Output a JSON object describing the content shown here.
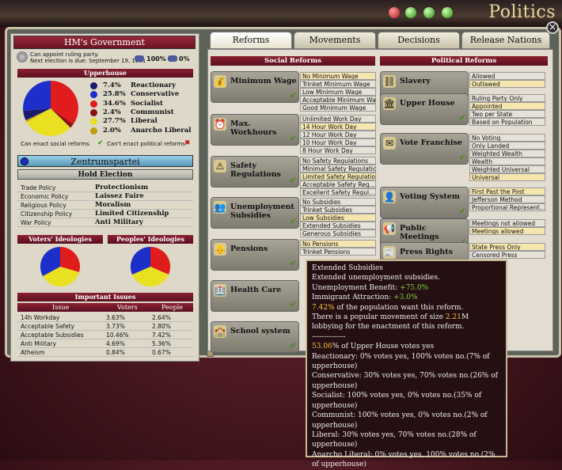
{
  "header": {
    "title": "Politics"
  },
  "government": {
    "title": "HM's Government",
    "line1": "Can appoint ruling party.",
    "line2": "Next election is due: September 19, 1901",
    "stat1": "100%",
    "stat2": "0%"
  },
  "upperhouse": {
    "title": "Upperhouse",
    "parties": [
      {
        "pct": "7.4%",
        "name": "Reactionary",
        "color": "#1a1a6a"
      },
      {
        "pct": "25.8%",
        "name": "Conservative",
        "color": "#1c2fc8"
      },
      {
        "pct": "34.6%",
        "name": "Socialist",
        "color": "#e01c1c"
      },
      {
        "pct": "2.4%",
        "name": "Communist",
        "color": "#8a1010"
      },
      {
        "pct": "27.7%",
        "name": "Liberal",
        "color": "#e8e020"
      },
      {
        "pct": "2.0%",
        "name": "Anarcho Liberal",
        "color": "#bfa010"
      }
    ],
    "note_social": "Can enact social reforms",
    "note_political": "Can't enact political reforms"
  },
  "party": {
    "name": "Zentrumspartei",
    "hold_election": "Hold Election",
    "policies": [
      {
        "k": "Trade Policy",
        "v": "Protectionism"
      },
      {
        "k": "Economic Policy",
        "v": "Laissez Faire"
      },
      {
        "k": "Religious Policy",
        "v": "Moralism"
      },
      {
        "k": "Citizenship Policy",
        "v": "Limited Citizenship"
      },
      {
        "k": "War Policy",
        "v": "Anti Military"
      }
    ]
  },
  "ideologies": {
    "voters": "Voters' Ideologies",
    "peoples": "Peoples' Ideologies"
  },
  "issues": {
    "title": "Important Issues",
    "cols": [
      "Issue",
      "Voters",
      "People"
    ],
    "rows": [
      [
        "14h Workday",
        "3.63%",
        "2.64%"
      ],
      [
        "Acceptable Safety",
        "3.73%",
        "2.80%"
      ],
      [
        "Acceptable Subsidies",
        "10.46%",
        "7.42%"
      ],
      [
        "Anti Military",
        "4.69%",
        "5.36%"
      ],
      [
        "Atheism",
        "0.84%",
        "0.67%"
      ]
    ]
  },
  "tabs": [
    "Reforms",
    "Movements",
    "Decisions",
    "Release Nations"
  ],
  "social": {
    "title": "Social Reforms",
    "reforms": [
      {
        "name": "Minimum Wage",
        "opts": [
          "No Minimum Wage",
          "Trinket Minimum Wage",
          "Low Minimum Wage",
          "Acceptable Minimum Wage",
          "Good Minimum Wage"
        ],
        "cur": 0
      },
      {
        "name": "Max. Workhours",
        "opts": [
          "Unlimited Work Day",
          "14 Hour Work Day",
          "12 Hour Work Day",
          "10 Hour Work Day",
          "8 Hour Work Day"
        ],
        "cur": 1
      },
      {
        "name": "Safety Regulations",
        "opts": [
          "No Safety Regulations",
          "Minimal Safety Regulations",
          "Limited Safety Regulations",
          "Acceptable Safety Reg…",
          "Excellent Safety Regul…"
        ],
        "cur": 2
      },
      {
        "name": "Unemployment Subsidies",
        "opts": [
          "No Subsidies",
          "Trinket Subsidies",
          "Low Subsidies",
          "Extended Subsidies",
          "Generous Subsidies"
        ],
        "cur": 2
      },
      {
        "name": "Pensions",
        "opts": [
          "No Pensions",
          "Trinket Pensions"
        ],
        "cur": 0
      },
      {
        "name": "Health Care",
        "opts": [],
        "cur": -1
      },
      {
        "name": "School system",
        "opts": [],
        "cur": -1
      }
    ]
  },
  "political": {
    "title": "Political Reforms",
    "reforms": [
      {
        "name": "Slavery",
        "opts": [
          "Allowed",
          "Outlawed"
        ],
        "cur": 1
      },
      {
        "name": "Upper House",
        "opts": [
          "Ruling Party Only",
          "Appointed",
          "Two per State",
          "Based on Population"
        ],
        "cur": 1
      },
      {
        "name": "Vote Franchise",
        "opts": [
          "No Voting",
          "Only Landed",
          "Weighted Wealth",
          "Wealth",
          "Weighted Universal",
          "Universal"
        ],
        "cur": 5
      },
      {
        "name": "Voting System",
        "opts": [
          "First Past the Post",
          "Jefferson Method",
          "Proportional Represent…"
        ],
        "cur": 0
      },
      {
        "name": "Public Meetings",
        "opts": [
          "Meetings not allowed",
          "Meetings allowed"
        ],
        "cur": 1
      },
      {
        "name": "Press Rights",
        "opts": [
          "State Press Only",
          "Censored Press"
        ],
        "cur": 0
      }
    ]
  },
  "tooltip": {
    "l1": "Extended Subsidies",
    "l2": "Extended unemployment subsidies.",
    "l3a": "Unemployment Benefit: ",
    "l3b": "+75.0%",
    "l4a": "Immigrant Attraction: ",
    "l4b": "+3.0%",
    "l5a": "7.42%",
    "l5b": " of the population want this reform.",
    "l6a": "There is a popular movement of size ",
    "l6b": "2.21",
    "l6c": "M lobbying for the enactment of this reform.",
    "sep": "--------------",
    "l7a": "53.06",
    "l7b": "% of Upper House votes yes",
    "votes": [
      "Reactionary: 0% votes yes, 100% votes no.(7% of upperhouse)",
      "Conservative: 30% votes yes, 70% votes no.(26% of upperhouse)",
      "Socialist: 100% votes yes, 0% votes no.(35% of upperhouse)",
      "Communist: 100% votes yes, 0% votes no.(2% of upperhouse)",
      "Liberal: 30% votes yes, 70% votes no.(28% of upperhouse)",
      "Anarcho Liberal: 0% votes yes, 100% votes no.(2% of upperhouse)"
    ]
  },
  "icons": {
    "top": [
      "red-sphere-icon",
      "check-icon",
      "globe-icon",
      "globe-icon"
    ]
  }
}
